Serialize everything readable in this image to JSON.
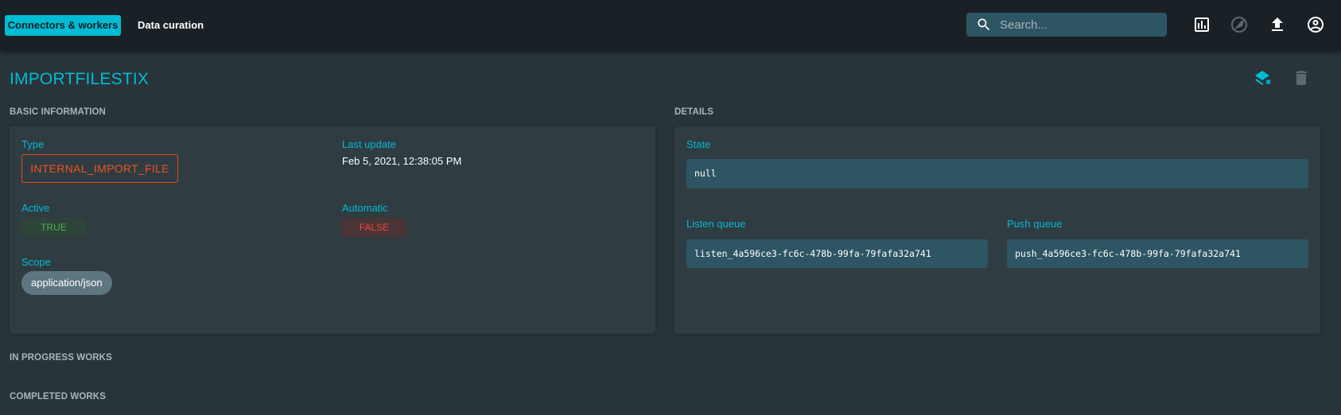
{
  "nav": {
    "connectors_label": "Connectors & workers",
    "curation_label": "Data curation"
  },
  "search": {
    "placeholder": "Search..."
  },
  "top_icons": [
    "chart-icon",
    "explore-icon",
    "upload-icon",
    "account-icon"
  ],
  "page": {
    "title": "IMPORTFILESTIX"
  },
  "actions": [
    "layers-clear-icon",
    "delete-icon"
  ],
  "basic_information": {
    "heading": "BASIC INFORMATION",
    "type_label": "Type",
    "type_value": "INTERNAL_IMPORT_FILE",
    "last_update_label": "Last update",
    "last_update_value": "Feb 5, 2021, 12:38:05 PM",
    "active_label": "Active",
    "active_value": "TRUE",
    "automatic_label": "Automatic",
    "automatic_value": "FALSE",
    "scope_label": "Scope",
    "scope_value": "application/json"
  },
  "details": {
    "heading": "DETAILS",
    "state_label": "State",
    "state_value": "null",
    "listen_label": "Listen queue",
    "listen_value": "listen_4a596ce3-fc6c-478b-99fa-79fafa32a741",
    "push_label": "Push queue",
    "push_value": "push_4a596ce3-fc6c-478b-99fa-79fafa32a741"
  },
  "sections": {
    "in_progress": "IN PROGRESS WORKS",
    "completed": "COMPLETED WORKS"
  },
  "colors": {
    "accent": "#00bcd4",
    "danger": "#f44336",
    "success": "#4caf50",
    "chip_orange": "#f4511e"
  }
}
